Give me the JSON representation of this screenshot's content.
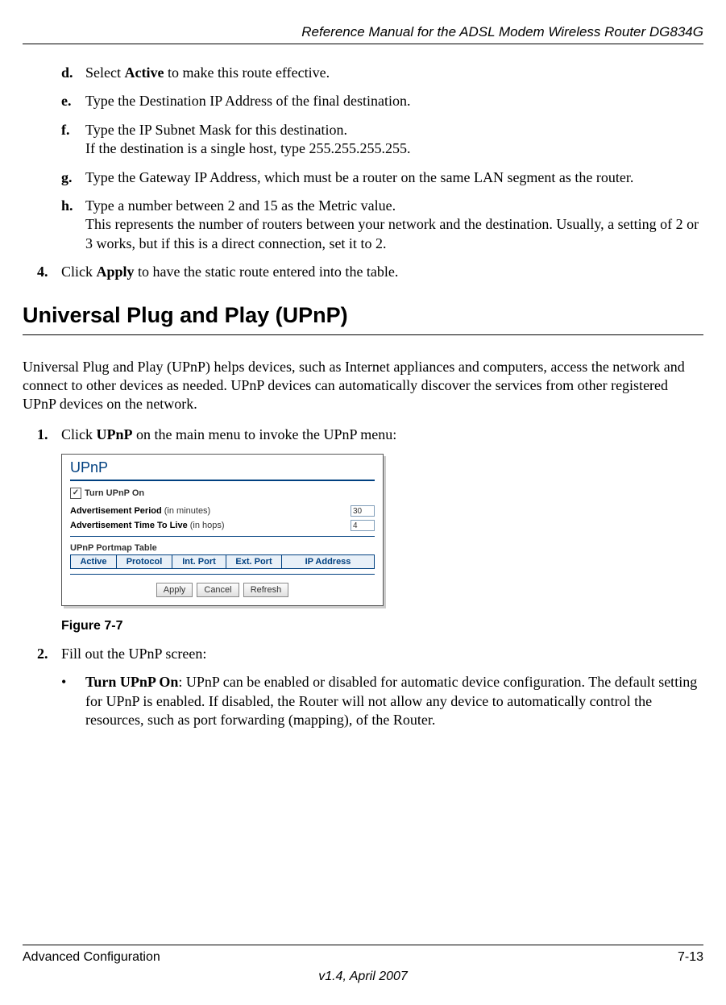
{
  "header": {
    "running_head": "Reference Manual for the ADSL Modem Wireless Router DG834G"
  },
  "steps_letter": [
    {
      "marker": "d.",
      "text_parts": [
        "Select ",
        "Active",
        " to make this route effective."
      ]
    },
    {
      "marker": "e.",
      "text_parts": [
        "Type the Destination IP Address of the final destination."
      ]
    },
    {
      "marker": "f.",
      "text_parts": [
        "Type the IP Subnet Mask for this destination.\nIf the destination is a single host, type 255.255.255.255."
      ]
    },
    {
      "marker": "g.",
      "text_parts": [
        "Type the Gateway IP Address, which must be a router on the same LAN segment as the router."
      ]
    },
    {
      "marker": "h.",
      "text_parts": [
        "Type a number between 2 and 15 as the Metric value.\nThis represents the number of routers between your network and the destination. Usually, a setting of 2 or 3 works, but if this is a direct connection, set it to 2."
      ]
    }
  ],
  "step4": {
    "marker": "4.",
    "pre": "Click ",
    "bold": "Apply",
    "post": " to have the static route entered into the table."
  },
  "heading": "Universal Plug and Play (UPnP)",
  "intro_para": "Universal Plug and Play (UPnP) helps devices, such as Internet appliances and computers, access the network and connect to other devices as needed. UPnP devices can automatically discover the services from other registered UPnP devices on the network.",
  "step1": {
    "marker": "1.",
    "pre": "Click ",
    "bold": "UPnP",
    "post": " on the main menu to invoke the UPnP menu:"
  },
  "figure": {
    "title": "UPnP",
    "turn_on_label": "Turn UPnP On",
    "turn_on_checked": true,
    "adv_period_bold": "Advertisement Period",
    "adv_period_rest": " (in minutes)",
    "adv_period_value": "30",
    "adv_ttl_bold": "Advertisement Time To Live",
    "adv_ttl_rest": " (in hops)",
    "adv_ttl_value": "4",
    "portmap_heading": "UPnP Portmap Table",
    "columns": [
      "Active",
      "Protocol",
      "Int. Port",
      "Ext. Port",
      "IP Address"
    ],
    "buttons": [
      "Apply",
      "Cancel",
      "Refresh"
    ]
  },
  "figure_caption": "Figure 7-7",
  "step2": {
    "marker": "2.",
    "text": "Fill out the UPnP screen:"
  },
  "bullet": {
    "bold": "Turn UPnP On",
    "rest": ": UPnP can be enabled or disabled for automatic device configuration. The default setting for UPnP is enabled. If disabled, the Router will not allow any device to automatically control the resources, such as port forwarding (mapping), of the Router."
  },
  "footer": {
    "left": "Advanced Configuration",
    "right": "7-13",
    "version": "v1.4, April 2007"
  }
}
